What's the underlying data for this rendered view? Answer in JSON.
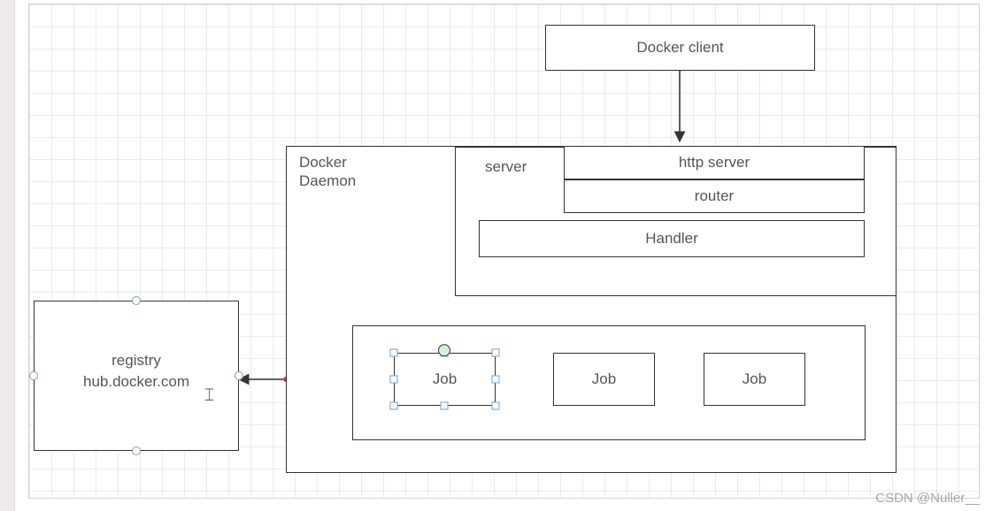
{
  "nodes": {
    "docker_client": "Docker client",
    "docker_daemon": "Docker\nDaemon",
    "server": "server",
    "http_server": "http server",
    "router": "router",
    "handler": "Handler",
    "job1": "Job",
    "job2": "Job",
    "job3": "Job",
    "registry_line1": "registry",
    "registry_line2": "hub.docker.com"
  },
  "watermark": "CSDN @Nuller__",
  "selection": {
    "target": "job1"
  },
  "text_cursor_indicator": "⌶"
}
